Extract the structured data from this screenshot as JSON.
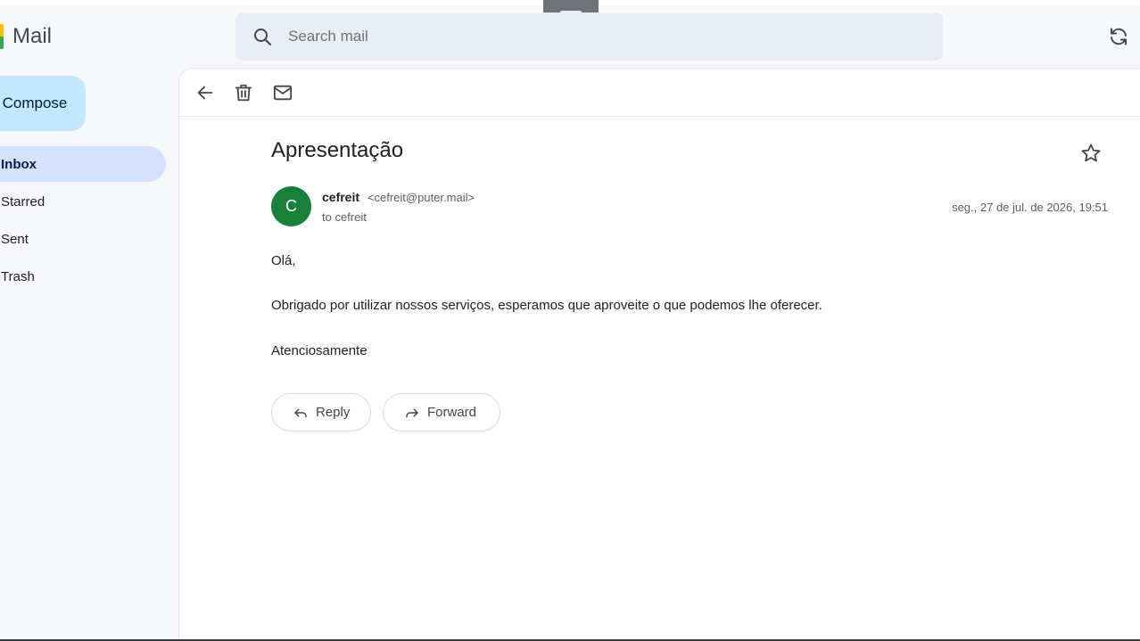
{
  "app": {
    "name": "Mail"
  },
  "search": {
    "placeholder": "Search mail"
  },
  "sidebar": {
    "compose_label": "Compose",
    "items": [
      {
        "label": "Inbox",
        "active": true
      },
      {
        "label": "Starred"
      },
      {
        "label": "Sent"
      },
      {
        "label": "Trash"
      }
    ]
  },
  "toolbar": {
    "icons": [
      "back-arrow-icon",
      "trash-icon",
      "mail-icon"
    ]
  },
  "message": {
    "subject": "Apresentação",
    "avatar_letter": "C",
    "sender_name": "cefreit",
    "sender_email": "<cefreit@puter.mail>",
    "to_line": "to cefreit",
    "date": "seg., 27 de jul. de 2026, 19:51",
    "body": [
      "Olá,",
      "Obrigado por utilizar nossos serviços, esperamos que aproveite o que podemos lhe oferecer.",
      "Atenciosamente"
    ]
  },
  "actions": {
    "reply_label": "Reply",
    "forward_label": "Forward"
  },
  "colors": {
    "accent": "#c2e7ff",
    "active_nav": "#d3e3fd",
    "avatar": "#188038",
    "background": "#f6f8fc"
  }
}
